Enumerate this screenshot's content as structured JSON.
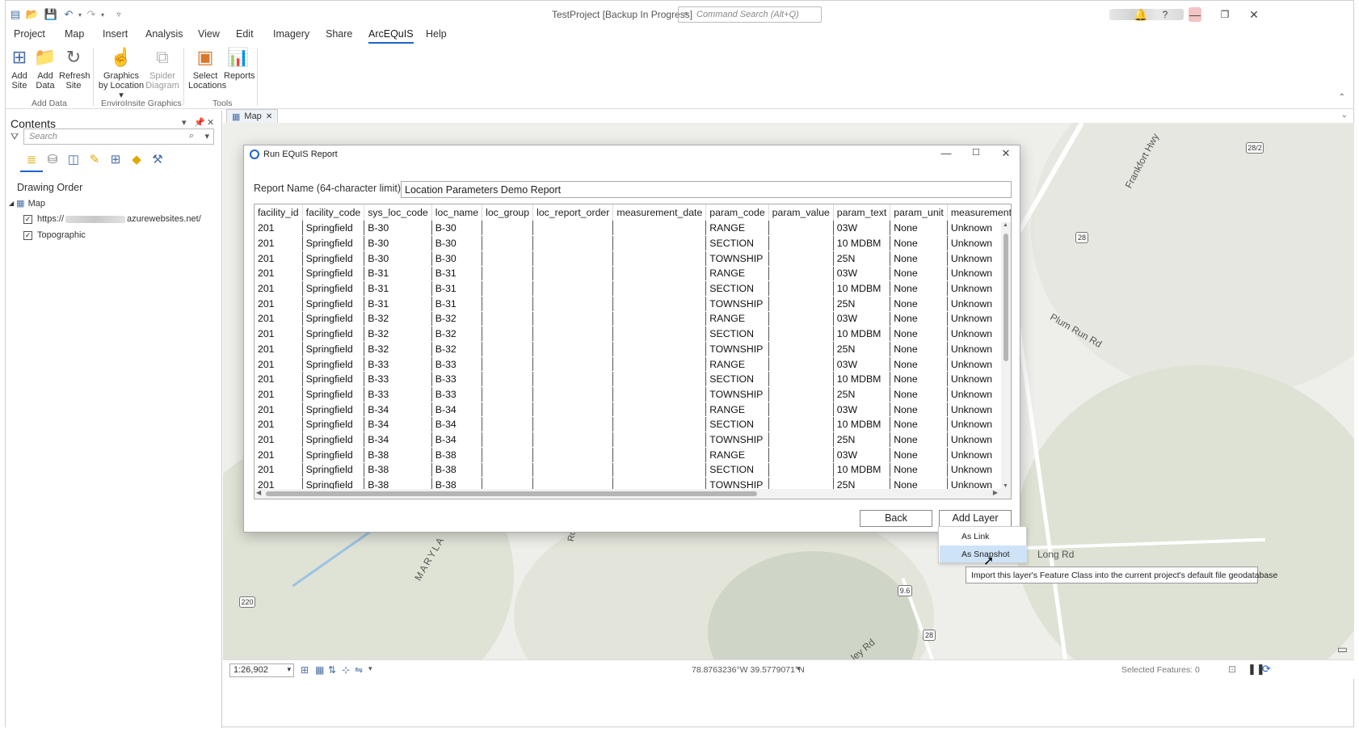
{
  "app": {
    "title": "TestProject [Backup In Progress]",
    "command_search_placeholder": "Command Search (Alt+Q)"
  },
  "ribbon_tabs": [
    "Project",
    "Map",
    "Insert",
    "Analysis",
    "View",
    "Edit",
    "Imagery",
    "Share",
    "ArcEQuIS",
    "Help"
  ],
  "active_tab": "ArcEQuIS",
  "ribbon": {
    "add_site": "Add Site",
    "add_data": "Add Data",
    "refresh_site": "Refresh Site",
    "graphics_by_location": "Graphics by Location",
    "spider_diagram": "Spider Diagram",
    "select_locations": "Select Locations",
    "reports": "Reports",
    "group_add_data": "Add Data",
    "group_envirolnsite": "EnviroInsite Graphics",
    "group_tools": "Tools"
  },
  "contents": {
    "title": "Contents",
    "search_placeholder": "Search",
    "drawing_order": "Drawing Order",
    "map_layer": "Map",
    "layer_url_prefix": "https://",
    "layer_url_suffix": "azurewebsites.net/",
    "layer_topographic": "Topographic"
  },
  "map": {
    "tab_label": "Map",
    "labels": {
      "frankfort_hwy": "Frankfort Hwy",
      "plum_run_rd": "Plum Run Rd",
      "long_rd": "Long Rd",
      "maryland": "MARYLA",
      "ley_rd": "ley Rd",
      "rd": "Rd"
    },
    "shields": [
      "28",
      "220",
      "9.6",
      "28",
      "28/2"
    ]
  },
  "statusbar": {
    "scale": "1:26,902",
    "coordinates": "78.8763236°W 39.5779071°N",
    "selected_features": "Selected Features: 0"
  },
  "dialog": {
    "title": "Run EQuIS Report",
    "report_name_label": "Report Name (64-character limit)",
    "report_name_value": "Location Parameters Demo Report",
    "columns": [
      "facility_id",
      "facility_code",
      "sys_loc_code",
      "loc_name",
      "loc_group",
      "loc_report_order",
      "measurement_date",
      "param_code",
      "param_value",
      "param_text",
      "param_unit",
      "measurement_me"
    ],
    "rows": [
      [
        "201",
        "Springfield",
        "B-30",
        "B-30",
        "",
        "",
        "",
        "RANGE",
        "",
        "03W",
        "None",
        "Unknown"
      ],
      [
        "201",
        "Springfield",
        "B-30",
        "B-30",
        "",
        "",
        "",
        "SECTION",
        "",
        "10 MDBM",
        "None",
        "Unknown"
      ],
      [
        "201",
        "Springfield",
        "B-30",
        "B-30",
        "",
        "",
        "",
        "TOWNSHIP",
        "",
        "25N",
        "None",
        "Unknown"
      ],
      [
        "201",
        "Springfield",
        "B-31",
        "B-31",
        "",
        "",
        "",
        "RANGE",
        "",
        "03W",
        "None",
        "Unknown"
      ],
      [
        "201",
        "Springfield",
        "B-31",
        "B-31",
        "",
        "",
        "",
        "SECTION",
        "",
        "10 MDBM",
        "None",
        "Unknown"
      ],
      [
        "201",
        "Springfield",
        "B-31",
        "B-31",
        "",
        "",
        "",
        "TOWNSHIP",
        "",
        "25N",
        "None",
        "Unknown"
      ],
      [
        "201",
        "Springfield",
        "B-32",
        "B-32",
        "",
        "",
        "",
        "RANGE",
        "",
        "03W",
        "None",
        "Unknown"
      ],
      [
        "201",
        "Springfield",
        "B-32",
        "B-32",
        "",
        "",
        "",
        "SECTION",
        "",
        "10 MDBM",
        "None",
        "Unknown"
      ],
      [
        "201",
        "Springfield",
        "B-32",
        "B-32",
        "",
        "",
        "",
        "TOWNSHIP",
        "",
        "25N",
        "None",
        "Unknown"
      ],
      [
        "201",
        "Springfield",
        "B-33",
        "B-33",
        "",
        "",
        "",
        "RANGE",
        "",
        "03W",
        "None",
        "Unknown"
      ],
      [
        "201",
        "Springfield",
        "B-33",
        "B-33",
        "",
        "",
        "",
        "SECTION",
        "",
        "10 MDBM",
        "None",
        "Unknown"
      ],
      [
        "201",
        "Springfield",
        "B-33",
        "B-33",
        "",
        "",
        "",
        "TOWNSHIP",
        "",
        "25N",
        "None",
        "Unknown"
      ],
      [
        "201",
        "Springfield",
        "B-34",
        "B-34",
        "",
        "",
        "",
        "RANGE",
        "",
        "03W",
        "None",
        "Unknown"
      ],
      [
        "201",
        "Springfield",
        "B-34",
        "B-34",
        "",
        "",
        "",
        "SECTION",
        "",
        "10 MDBM",
        "None",
        "Unknown"
      ],
      [
        "201",
        "Springfield",
        "B-34",
        "B-34",
        "",
        "",
        "",
        "TOWNSHIP",
        "",
        "25N",
        "None",
        "Unknown"
      ],
      [
        "201",
        "Springfield",
        "B-38",
        "B-38",
        "",
        "",
        "",
        "RANGE",
        "",
        "03W",
        "None",
        "Unknown"
      ],
      [
        "201",
        "Springfield",
        "B-38",
        "B-38",
        "",
        "",
        "",
        "SECTION",
        "",
        "10 MDBM",
        "None",
        "Unknown"
      ],
      [
        "201",
        "Springfield",
        "B-38",
        "B-38",
        "",
        "",
        "",
        "TOWNSHIP",
        "",
        "25N",
        "None",
        "Unknown"
      ]
    ],
    "back_label": "Back",
    "add_layer_label": "Add Layer",
    "menu": [
      "As Link",
      "As Snapshot"
    ],
    "highlighted_menu_item": "As Snapshot",
    "tooltip": "Import this layer's Feature Class into the current project's default file geodatabase"
  },
  "colors": {
    "accent": "#1f63c9",
    "menu_highlight": "#cfe3f7"
  }
}
